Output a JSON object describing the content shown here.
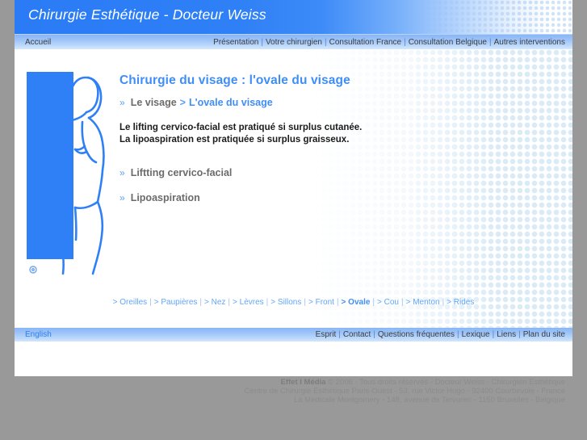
{
  "header": {
    "site_title": "Chirurgie Esthétique - Docteur Weiss"
  },
  "topnav": {
    "home_label": "Accueil",
    "items": [
      {
        "label": "Présentation"
      },
      {
        "label": "Votre chirurgien"
      },
      {
        "label": "Consultation France"
      },
      {
        "label": "Consultation Belgique"
      },
      {
        "label": "Autres interventions"
      }
    ],
    "separator": "|"
  },
  "illustration": {
    "alt_name": "female-figure-illustration",
    "copyright_mark": "©",
    "fill_color": "#2f80f6"
  },
  "main": {
    "page_title": "Chirurgie du visage : l'ovale du visage",
    "breadcrumb": {
      "bullet": "»",
      "parent": "Le visage",
      "arrow": ">",
      "current": "L'ovale du visage"
    },
    "paragraph_lines": [
      "Le lifting cervico-facial est pratiqué si surplus cutanée.",
      "La lipoaspiration est pratiquée si surplus graisseux."
    ],
    "procedures": [
      {
        "bullet": "»",
        "label": "Liftting cervico-facial"
      },
      {
        "bullet": "»",
        "label": "Lipoaspiration"
      }
    ]
  },
  "subnav": {
    "separator": "|",
    "items": [
      {
        "label": "> Oreilles",
        "current": false
      },
      {
        "label": "> Paupières",
        "current": false
      },
      {
        "label": "> Nez",
        "current": false
      },
      {
        "label": "> Lèvres",
        "current": false
      },
      {
        "label": "> Sillons",
        "current": false
      },
      {
        "label": "> Front",
        "current": false
      },
      {
        "label": "> Ovale",
        "current": true
      },
      {
        "label": "> Cou",
        "current": false
      },
      {
        "label": "> Menton",
        "current": false
      },
      {
        "label": "> Rides",
        "current": false
      }
    ]
  },
  "footerbar": {
    "language_label": "English",
    "separator": "|",
    "items": [
      {
        "label": "Esprit"
      },
      {
        "label": "Contact"
      },
      {
        "label": "Questions fréquentes"
      },
      {
        "label": "Lexique"
      },
      {
        "label": "Liens"
      },
      {
        "label": "Plan du site"
      }
    ]
  },
  "copyright": {
    "brand": "Effet I Média",
    "line1_rest": " © 2006 - Tous droits réservés - Docteur Weiss - Chirurgien Esthétique",
    "line2": "Centre de Chirurgie Esthétique Paris-Ouest - 53, rue Victor Hugo - 92400 Courbevoie - France",
    "line3": "La Médicale Montgomery - 148, avenue de Tervuren - 1150 Bruxelles - Belgique"
  },
  "colors": {
    "brand_blue": "#2f80f6",
    "link_blue": "#62a6f8",
    "title_blue": "#3f8ef7",
    "page_bg": "#999999"
  }
}
